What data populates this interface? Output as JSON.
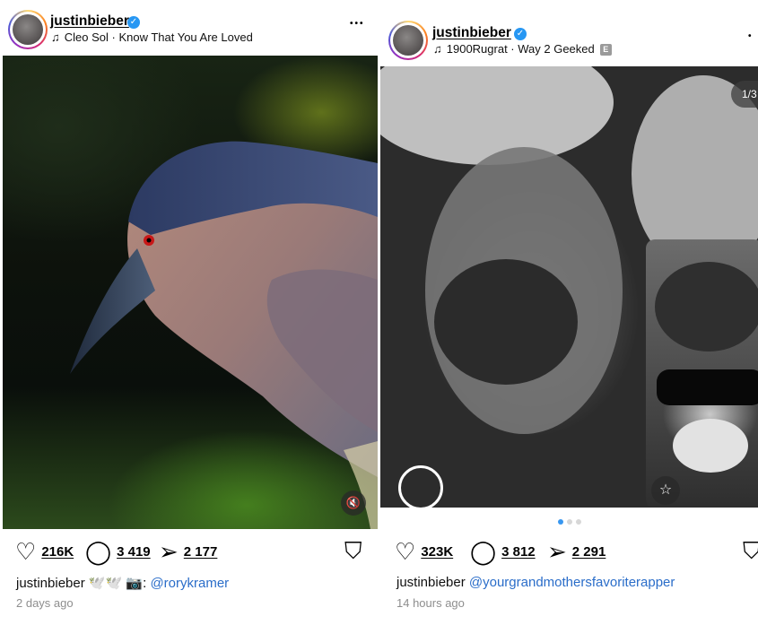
{
  "posts": [
    {
      "username": "justinbieber",
      "verified_mark": "✓",
      "music_note": "♫",
      "music": "Cleo Sol · Know That You Are Loved",
      "more": "•••",
      "media_description_icon": "muted-speaker-icon",
      "mute_glyph": "🔇",
      "likes": "216K",
      "comments": "3 419",
      "shares": "2 177",
      "caption_user": "justinbieber",
      "caption_emojis": "🕊️🕊️ 📷:",
      "caption_mention": "@rorykramer",
      "timestamp": "2 days ago"
    },
    {
      "username": "justinbieber",
      "verified_mark": "✓",
      "music_note": "♫",
      "music": "1900Rugrat · Way 2 Geeked",
      "explicit": "E",
      "more": "•",
      "slide_indicator": "1/3",
      "star_glyph": "☆",
      "likes": "323K",
      "comments": "3 812",
      "shares": "2 291",
      "caption_user": "justinbieber",
      "caption_mention": "@yourgrandmothersfavoriterapper",
      "timestamp": "14 hours ago"
    }
  ],
  "icons": {
    "like": "♡",
    "comment": "◯",
    "share": "➢",
    "save": "⛉"
  },
  "colors": {
    "verified": "#2797f3",
    "mention": "#2a6dc9",
    "carousel_active": "#3897f0",
    "timestamp": "#8e8e8e"
  }
}
